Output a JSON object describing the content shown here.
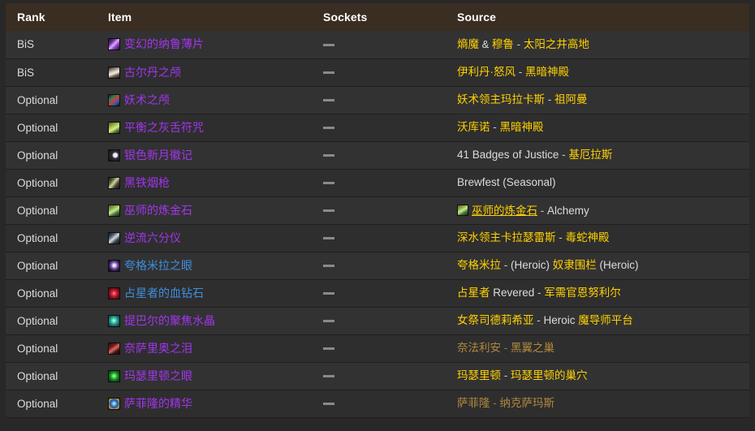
{
  "table": {
    "columns": [
      {
        "key": "rank",
        "label": "Rank"
      },
      {
        "key": "item",
        "label": "Item"
      },
      {
        "key": "sockets",
        "label": "Sockets"
      },
      {
        "key": "source",
        "label": "Source"
      }
    ],
    "socket_placeholder": "—",
    "rows": [
      {
        "rank": "BiS",
        "item": {
          "name": "变幻的纳鲁薄片",
          "quality": "epic",
          "icon": "item-icon-shifting-naaru-sliver"
        },
        "sockets": "—",
        "source": {
          "link": "熵魔 & 穆鲁",
          "separator": "-",
          "tail_link": "太阳之井高地",
          "dim": false
        }
      },
      {
        "rank": "BiS",
        "item": {
          "name": "古尔丹之颅",
          "quality": "epic",
          "icon": "item-icon-skull-of-guldan"
        },
        "sockets": "—",
        "source": {
          "link": "伊利丹·怒风",
          "separator": "-",
          "tail_link": "黑暗神殿",
          "dim": false
        }
      },
      {
        "rank": "Optional",
        "item": {
          "name": "妖术之颅",
          "quality": "epic",
          "icon": "item-icon-hex-shrunken-head"
        },
        "sockets": "—",
        "source": {
          "link": "妖术领主玛拉卡斯",
          "separator": "-",
          "tail_link": "祖阿曼",
          "dim": false
        }
      },
      {
        "rank": "Optional",
        "item": {
          "name": "平衡之灰舌符咒",
          "quality": "epic",
          "icon": "item-icon-ashtongue-talisman"
        },
        "sockets": "—",
        "source": {
          "link": "沃库诺",
          "separator": "-",
          "tail_link": "黑暗神殿",
          "dim": false
        }
      },
      {
        "rank": "Optional",
        "item": {
          "name": "银色新月徽记",
          "quality": "epic",
          "icon": "item-icon-silver-crescent"
        },
        "sockets": "—",
        "source": {
          "plain": "41 Badges of Justice",
          "separator": "-",
          "tail_link": "基厄拉斯",
          "dim": false
        }
      },
      {
        "rank": "Optional",
        "item": {
          "name": "黑铁烟枪",
          "quality": "epic",
          "icon": "item-icon-dark-iron-smoking-pipe"
        },
        "sockets": "—",
        "source": {
          "plain": "Brewfest (Seasonal)",
          "dim": false
        }
      },
      {
        "rank": "Optional",
        "item": {
          "name": "巫师的炼金石",
          "quality": "epic",
          "icon": "item-icon-alchemist-stone"
        },
        "sockets": "—",
        "source": {
          "icon": "source-icon-alchemist-stone",
          "link": "巫师的炼金石",
          "separator": "-",
          "tail_plain": "Alchemy",
          "dim": false
        }
      },
      {
        "rank": "Optional",
        "item": {
          "name": "逆流六分仪",
          "quality": "epic",
          "icon": "item-icon-sextant-unstable-currents"
        },
        "sockets": "—",
        "source": {
          "link": "深水领主卡拉瑟雷斯",
          "separator": "-",
          "tail_link": "毒蛇神殿",
          "dim": false
        }
      },
      {
        "rank": "Optional",
        "item": {
          "name": "夸格米拉之眼",
          "quality": "rare",
          "icon": "item-icon-quagmirrans-eye"
        },
        "sockets": "—",
        "source": {
          "link": "夸格米拉",
          "separator": "-",
          "tail_link": "奴隶围栏",
          "tail_plain": "(Heroic)",
          "dim": false
        }
      },
      {
        "rank": "Optional",
        "item": {
          "name": "占星者的血钻石",
          "quality": "rare",
          "icon": "item-icon-bloodlust-brooch"
        },
        "sockets": "—",
        "source": {
          "link": "占星者",
          "plain_mid": "Revered",
          "separator": "-",
          "tail_link": "军需官恩努利尔",
          "dim": false
        }
      },
      {
        "rank": "Optional",
        "item": {
          "name": "提巴尔的聚焦水晶",
          "quality": "epic",
          "icon": "item-icon-xiri-gift"
        },
        "sockets": "—",
        "source": {
          "link": "女祭司德莉希亚",
          "separator": "-",
          "tail_plain": "Heroic",
          "tail_link": "魔导师平台",
          "dim": false
        }
      },
      {
        "rank": "Optional",
        "item": {
          "name": "奈萨里奥之泪",
          "quality": "epic",
          "icon": "item-icon-nefarians-tear"
        },
        "sockets": "—",
        "source": {
          "link": "奈法利安",
          "separator": "-",
          "tail_link": "黑翼之巢",
          "dim": true
        }
      },
      {
        "rank": "Optional",
        "item": {
          "name": "玛瑟里顿之眼",
          "quality": "epic",
          "icon": "item-icon-eye-of-moam"
        },
        "sockets": "—",
        "source": {
          "link": "玛瑟里顿",
          "separator": "-",
          "tail_link": "玛瑟里顿的巢穴",
          "dim": false
        }
      },
      {
        "rank": "Optional",
        "item": {
          "name": "萨菲隆的精华",
          "quality": "epic",
          "icon": "item-icon-phase-blade-essence"
        },
        "sockets": "—",
        "source": {
          "link": "萨菲隆",
          "separator": "-",
          "tail_link": "纳克萨玛斯",
          "dim": true
        }
      }
    ]
  },
  "colors": {
    "header_bg": "#3a2d21",
    "row_odd": "#323232",
    "row_even": "#2e2e2e",
    "page_bg": "#282828",
    "quality_epic": "#a335ee",
    "quality_rare": "#3f8fe0",
    "link_gold": "#ffd100",
    "link_gold_dim": "#b0893f",
    "text": "#dcdcdc",
    "socket_dash": "#8a8a8a"
  }
}
